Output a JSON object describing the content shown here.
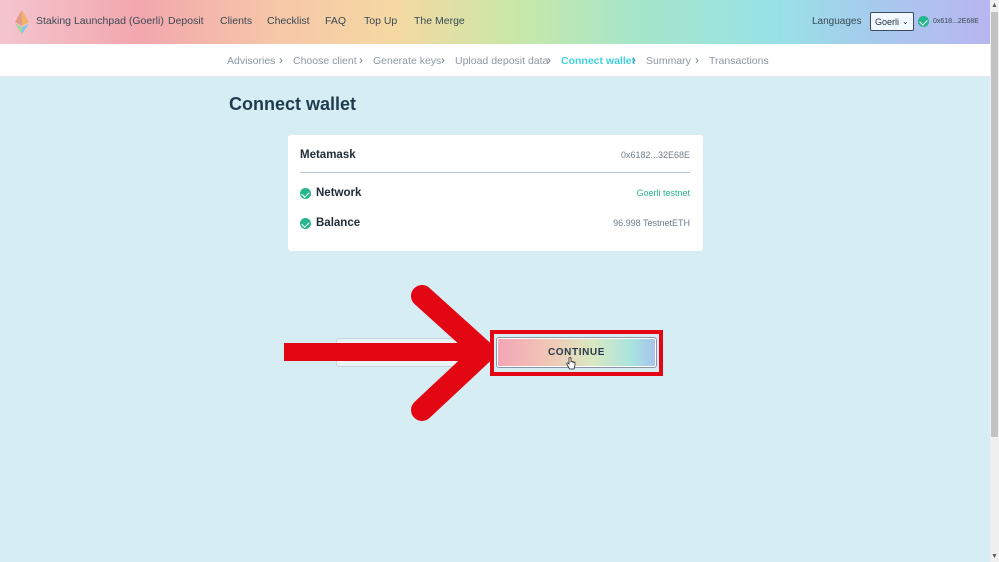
{
  "header": {
    "brand": "Staking Launchpad (Goerli)",
    "nav": [
      "Deposit",
      "Clients",
      "Checklist",
      "FAQ",
      "Top Up",
      "The Merge"
    ],
    "languages": "Languages",
    "network": "Goerli",
    "account": "0x618...2E68E",
    "icons": {
      "logo": "ethereum-logo",
      "chevron": "chevron-down-icon",
      "status": "check-circle-icon"
    }
  },
  "breadcrumb": {
    "steps": [
      "Advisories",
      "Choose client",
      "Generate keys",
      "Upload deposit data",
      "Connect wallet",
      "Summary",
      "Transactions"
    ],
    "active": "Connect wallet",
    "separator": ">"
  },
  "main": {
    "title": "Connect wallet",
    "card": {
      "wallet": "Metamask",
      "address": "0x6182...32E68E",
      "rows": [
        {
          "label": "Network",
          "value": "Goerli testnet"
        },
        {
          "label": "Balance",
          "value": "96.998 TestnetETH"
        }
      ]
    },
    "continue_label": "CONTINUE"
  },
  "colors": {
    "accent": "#3fd2e0",
    "success": "#27b58c",
    "annotation": "#e30613",
    "background": "#d6eef3"
  }
}
